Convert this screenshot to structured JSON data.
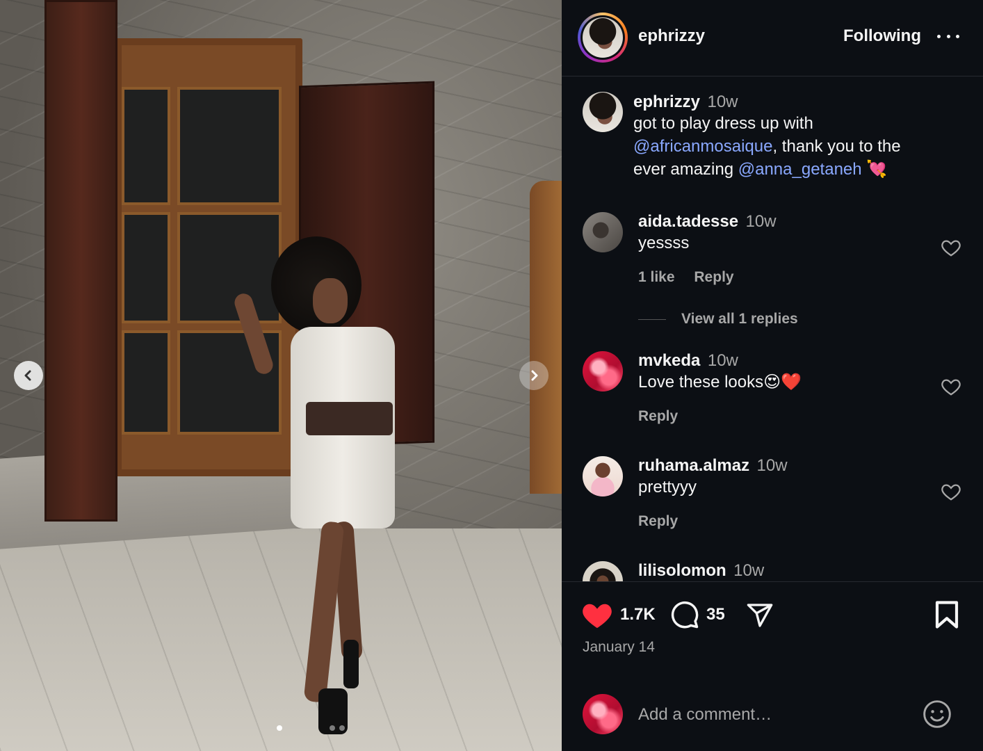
{
  "post": {
    "username": "ephrizzy",
    "follow_label": "Following",
    "caption_time": "10w",
    "caption_line1": "got to play dress up with",
    "mention1": "@africanmosaique",
    "caption_line2_rest": ", thank you to the",
    "caption_line3": "ever amazing ",
    "mention2": "@anna_getaneh",
    "caption_emoji": "💘"
  },
  "comments": [
    {
      "username": "aida.tadesse",
      "time": "10w",
      "text": "yessss",
      "likes": "1 like",
      "reply": "Reply",
      "view_replies": "View all 1 replies"
    },
    {
      "username": "mvkeda",
      "time": "10w",
      "text": "Love these looks😍❤️",
      "reply": "Reply"
    },
    {
      "username": "ruhama.almaz",
      "time": "10w",
      "text": "prettyyy",
      "reply": "Reply"
    },
    {
      "username": "lilisolomon",
      "time": "10w"
    }
  ],
  "actions": {
    "like_count": "1.7K",
    "comment_count": "35",
    "date": "January 14"
  },
  "composer": {
    "placeholder": "Add a comment…"
  },
  "colors": {
    "like_red": "#ff3040",
    "mention_blue": "#8aa8ff",
    "background": "#0c0f14"
  },
  "icons": [
    "chevron-left-icon",
    "chevron-right-icon",
    "more-icon",
    "heart-icon",
    "comment-icon",
    "share-icon",
    "bookmark-icon",
    "emoji-icon"
  ]
}
